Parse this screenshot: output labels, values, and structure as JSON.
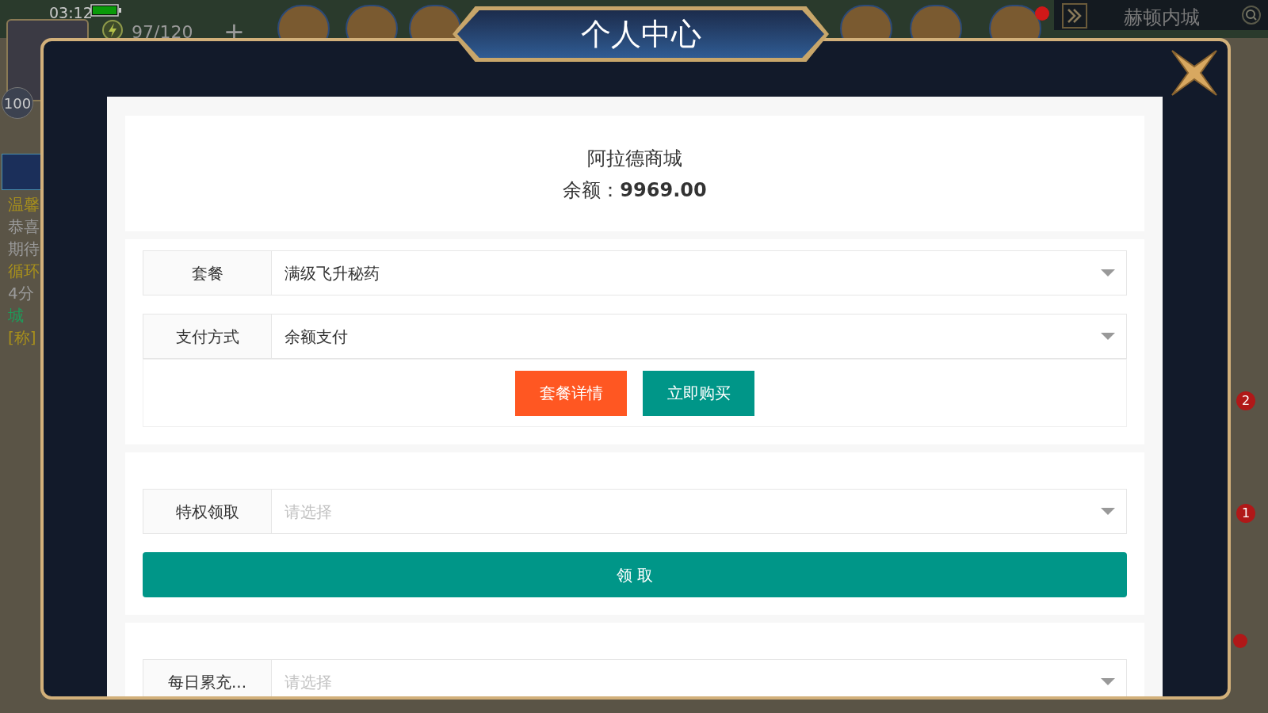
{
  "hud": {
    "time": "03:12",
    "level": "100",
    "energy": "97/120",
    "plus": "+",
    "location": "赫顿内城"
  },
  "side_texts": [
    {
      "text": "温馨",
      "color": "#a8901c"
    },
    {
      "text": "恭喜",
      "color": "#9a9a9a"
    },
    {
      "text": "期待",
      "color": "#9a9a9a"
    },
    {
      "text": "循环",
      "color": "#a8901c"
    },
    {
      "text": "4分",
      "color": "#9a9a9a"
    },
    {
      "text": "城",
      "color": "#1f9a5a"
    },
    {
      "text": "[称]",
      "color": "#a8901c"
    }
  ],
  "badges": [
    "2",
    "1"
  ],
  "dialog": {
    "title": "个人中心",
    "shop": {
      "name": "阿拉德商城",
      "balance_label": "余额：",
      "balance": "9969.00"
    },
    "sections": [
      {
        "fields": [
          {
            "label": "套餐",
            "value": "满级飞升秘药"
          },
          {
            "label": "支付方式",
            "value": "余额支付"
          }
        ],
        "buttons": [
          {
            "label": "套餐详情",
            "kind": "detail"
          },
          {
            "label": "立即购买",
            "kind": "buy"
          }
        ]
      },
      {
        "fields": [
          {
            "label": "特权领取",
            "placeholder": "请选择"
          }
        ],
        "buttons": [
          {
            "label": "领 取",
            "kind": "wide"
          }
        ]
      },
      {
        "fields": [
          {
            "label": "每日累充...",
            "placeholder": "请选择"
          }
        ]
      }
    ]
  }
}
